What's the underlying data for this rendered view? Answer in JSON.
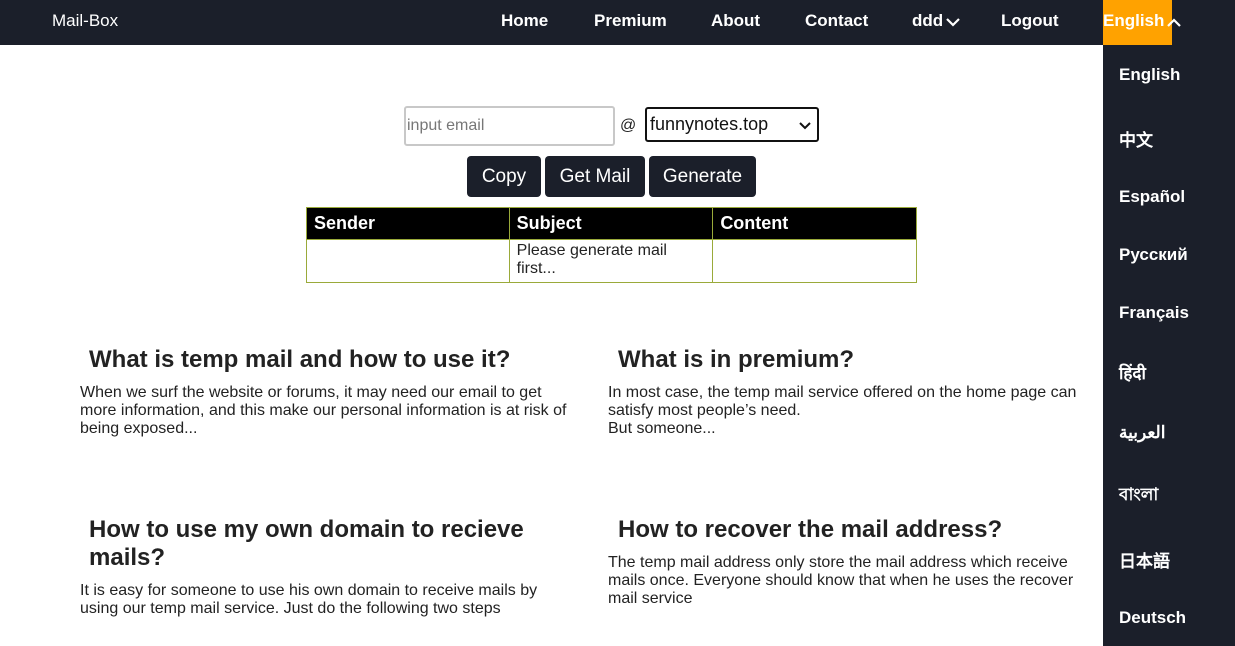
{
  "nav": {
    "brand": "Mail-Box",
    "links": [
      "Home",
      "Premium",
      "About",
      "Contact",
      "ddd",
      "Logout"
    ],
    "language_current": "English"
  },
  "languages": [
    "English",
    "中文",
    "Español",
    "Русский",
    "Français",
    "हिंदी",
    "العربية",
    "বাংলা",
    "日本語",
    "Deutsch"
  ],
  "form": {
    "email_placeholder": "input email",
    "at": "@",
    "domain_selected": "funnynotes.top",
    "buttons": [
      "Copy",
      "Get Mail",
      "Generate"
    ]
  },
  "table": {
    "headers": [
      "Sender",
      "Subject",
      "Content"
    ],
    "rows": [
      [
        "",
        "Please generate mail first...",
        ""
      ]
    ]
  },
  "cards": [
    {
      "title": "What is temp mail and how to use it?",
      "text": "When we surf the website or forums, it may need our email to get more information, and this make our personal information is at risk of being exposed..."
    },
    {
      "title": "What is in premium?",
      "text": "In most case, the temp mail service offered on the home page can satisfy most people’s need.\nBut someone..."
    },
    {
      "title": "How to use my own domain to recieve mails?",
      "text": "It is easy for someone to use his own domain to receive mails by using our temp mail service. Just do the following two steps"
    },
    {
      "title": "How to recover the mail address?",
      "text": "The temp mail address only store the mail address which receive mails once. Everyone should know that when he uses the recover mail service"
    }
  ]
}
